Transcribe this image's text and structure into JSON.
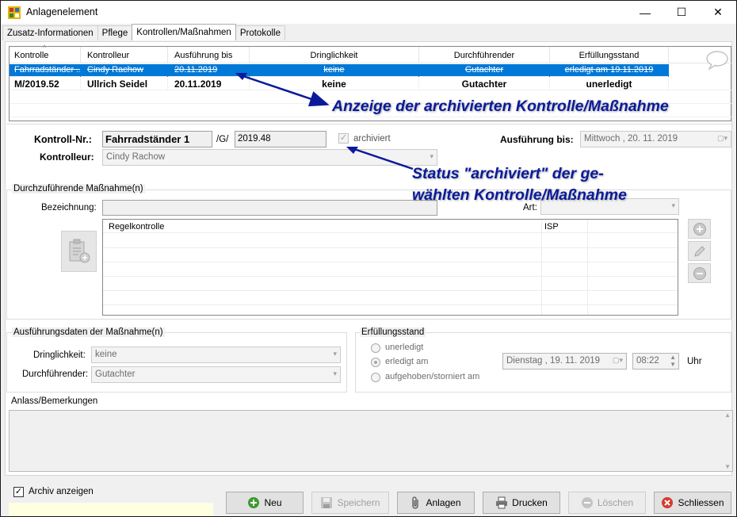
{
  "window": {
    "title": "Anlagenelement",
    "minimize": "—",
    "maximize": "☐",
    "close": "✕"
  },
  "tabs": [
    "Zusatz-Informationen",
    "Pflege",
    "Kontrollen/Maßnahmen",
    "Protokolle"
  ],
  "grid": {
    "columns": [
      "Kontrolle",
      "Kontrolleur",
      "Ausführung bis",
      "Dringlichkeit",
      "Durchführender",
      "Erfüllungsstand"
    ],
    "sort_indicator": "^",
    "rows": [
      [
        "Fahrradständer ...",
        "Cindy Rachow",
        "20.11.2019",
        "keine",
        "Gutachter",
        "erledigt am 19.11.2019"
      ],
      [
        "M/2019.52",
        "Ullrich Seidel",
        "20.11.2019",
        "keine",
        "Gutachter",
        "unerledigt"
      ]
    ]
  },
  "annotations": {
    "archived_display": "Anzeige der archivierten Kontrolle/Maßnahme",
    "archived_status_line1": "Status \"archiviert\" der ge-",
    "archived_status_line2": "wählten Kontrolle/Maßnahme"
  },
  "form": {
    "kontroll_nr_label": "Kontroll-Nr.:",
    "kontroll_nr_value": "Fahrradständer 1",
    "separator": "/G/",
    "kontroll_nr_suffix": "2019.48",
    "archiviert_label": "archiviert",
    "ausfuehrung_label": "Ausführung bis:",
    "ausfuehrung_value": "Mittwoch  , 20. 11. 2019",
    "kontrolleur_label": "Kontrolleur:",
    "kontrolleur_value": "Cindy Rachow"
  },
  "massnahme": {
    "group_title": "Durchzuführende Maßnahme(n)",
    "bezeichnung_label": "Bezeichnung:",
    "bezeichnung_value": "",
    "art_label": "Art:",
    "art_value": "",
    "list_rows": [
      [
        "Regelkontrolle",
        "ISP"
      ]
    ]
  },
  "ausfuehrungsdaten": {
    "group_title": "Ausführungsdaten der Maßnahme(n)",
    "dringlichkeit_label": "Dringlichkeit:",
    "dringlichkeit_value": "keine",
    "durchfuehrender_label": "Durchführender:",
    "durchfuehrender_value": "Gutachter"
  },
  "erfuellungsstand": {
    "group_title": "Erfüllungsstand",
    "options": [
      "unerledigt",
      "erledigt am",
      "aufgehoben/storniert am"
    ],
    "selected": "erledigt am",
    "date_value": "Dienstag  , 19. 11. 2019",
    "time_value": "08:22",
    "uhr_label": "Uhr"
  },
  "anlass": {
    "label": "Anlass/Bemerkungen",
    "value": ""
  },
  "archiv_checkbox": {
    "label": "Archiv anzeigen",
    "checked": true
  },
  "buttons": {
    "neu": "Neu",
    "speichern": "Speichern",
    "anlagen": "Anlagen",
    "drucken": "Drucken",
    "loeschen": "Löschen",
    "schliessen": "Schliessen"
  },
  "colors": {
    "selection": "#0078d7",
    "annotation": "#0a1a9a"
  }
}
